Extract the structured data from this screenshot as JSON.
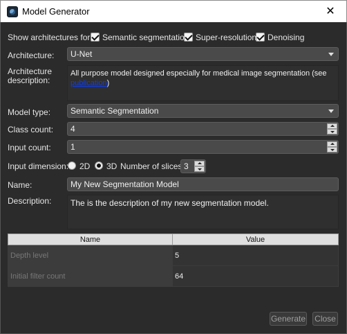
{
  "window": {
    "title": "Model Generator",
    "close_glyph": "✕",
    "icon": "app-icon"
  },
  "filters": {
    "label": "Show architectures for:",
    "options": [
      {
        "label": "Semantic segmentation",
        "checked": true
      },
      {
        "label": "Super-resolution",
        "checked": true
      },
      {
        "label": "Denoising",
        "checked": true
      }
    ]
  },
  "architecture": {
    "label": "Architecture:",
    "value": "U-Net"
  },
  "arch_description": {
    "label_line1": "Architecture",
    "label_line2": "description:",
    "text": "All purpose model designed especially for medical image segmentation (see ",
    "link": "publication",
    "tail": ")"
  },
  "model_type": {
    "label": "Model type:",
    "value": "Semantic Segmentation"
  },
  "class_count": {
    "label": "Class count:",
    "value": "4"
  },
  "input_count": {
    "label": "Input count:",
    "value": "1"
  },
  "input_dimension": {
    "label": "Input dimension:",
    "opt_2d": "2D",
    "opt_3d": "3D",
    "selected": "3D",
    "slices_label": "Number of slices:",
    "slices_value": "3"
  },
  "name": {
    "label": "Name:",
    "value": "My New Segmentation Model"
  },
  "description": {
    "label": "Description:",
    "value": "The is the description of my new segmentation model."
  },
  "params_table": {
    "headers": [
      "Name",
      "Value"
    ],
    "rows": [
      {
        "name": "Depth level",
        "value": "5"
      },
      {
        "name": "Initial filter count",
        "value": "64"
      }
    ]
  },
  "buttons": {
    "generate": "Generate",
    "close": "Close"
  }
}
